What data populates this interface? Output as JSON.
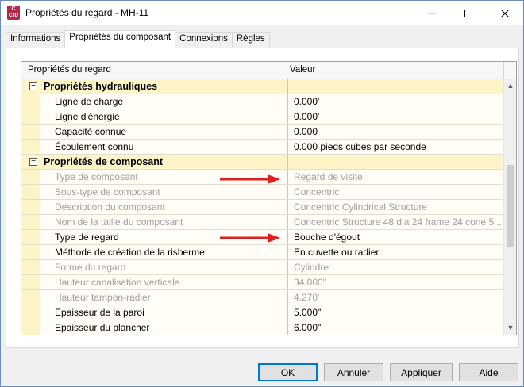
{
  "window": {
    "title": "Propriétés du regard - MH-11",
    "app_icon": {
      "name": "civil3d-icon",
      "line1": "C",
      "line2": "C3D",
      "color": "#b02a4b"
    },
    "controls": [
      "minimize-icon",
      "maximize-icon",
      "close-icon"
    ]
  },
  "tabs": [
    {
      "label": "Informations",
      "active": false
    },
    {
      "label": "Propriétés du composant",
      "active": true
    },
    {
      "label": "Connexions",
      "active": false
    },
    {
      "label": "Règles",
      "active": false
    }
  ],
  "grid": {
    "columns": [
      "Propriétés du regard",
      "Valeur"
    ],
    "rows": [
      {
        "type": "category",
        "name": "Propriétés hydrauliques",
        "value": "",
        "expander": "⊟"
      },
      {
        "type": "item",
        "name": "Ligne de charge",
        "value": "0.000'",
        "disabled": false
      },
      {
        "type": "item",
        "name": "Ligne d'énergie",
        "value": "0.000'",
        "disabled": false
      },
      {
        "type": "item",
        "name": "Capacité connue",
        "value": "0.000",
        "disabled": false
      },
      {
        "type": "item",
        "name": "Écoulement connu",
        "value": "0.000 pieds cubes par seconde",
        "disabled": false
      },
      {
        "type": "category",
        "name": "Propriétés de composant",
        "value": "",
        "expander": "⊟"
      },
      {
        "type": "item",
        "name": "Type de composant",
        "value": "Regard de visite",
        "disabled": true
      },
      {
        "type": "item",
        "name": "Sous-type de composant",
        "value": "Concentric",
        "disabled": true
      },
      {
        "type": "item",
        "name": "Description du composant",
        "value": "Concentric Cylindrical Structure",
        "disabled": true
      },
      {
        "type": "item",
        "name": "Nom de la taille du composant",
        "value": "Concentric Structure 48 dia 24 frame 24 cone 5 ...",
        "disabled": true
      },
      {
        "type": "item",
        "name": "Type de regard",
        "value": "Bouche d'égout",
        "disabled": false
      },
      {
        "type": "item",
        "name": "Méthode de création de la risberme",
        "value": "En cuvette ou radier",
        "disabled": false
      },
      {
        "type": "item",
        "name": "Forme du regard",
        "value": "Cylindre",
        "disabled": true
      },
      {
        "type": "item",
        "name": "Hauteur canalisation verticale",
        "value": "34.000\"",
        "disabled": true
      },
      {
        "type": "item",
        "name": "Hauteur tampon-radier",
        "value": "4.270'",
        "disabled": true
      },
      {
        "type": "item",
        "name": "Epaisseur de la paroi",
        "value": "5.000\"",
        "disabled": false
      },
      {
        "type": "item",
        "name": "Epaisseur du plancher",
        "value": "6.000\"",
        "disabled": false
      }
    ],
    "scroll": {
      "up": "▲",
      "down": "▼"
    }
  },
  "annotations": {
    "arrow_color": "#e0201e"
  },
  "buttons": {
    "ok": "OK",
    "cancel": "Annuler",
    "apply": "Appliquer",
    "help": "Aide"
  }
}
